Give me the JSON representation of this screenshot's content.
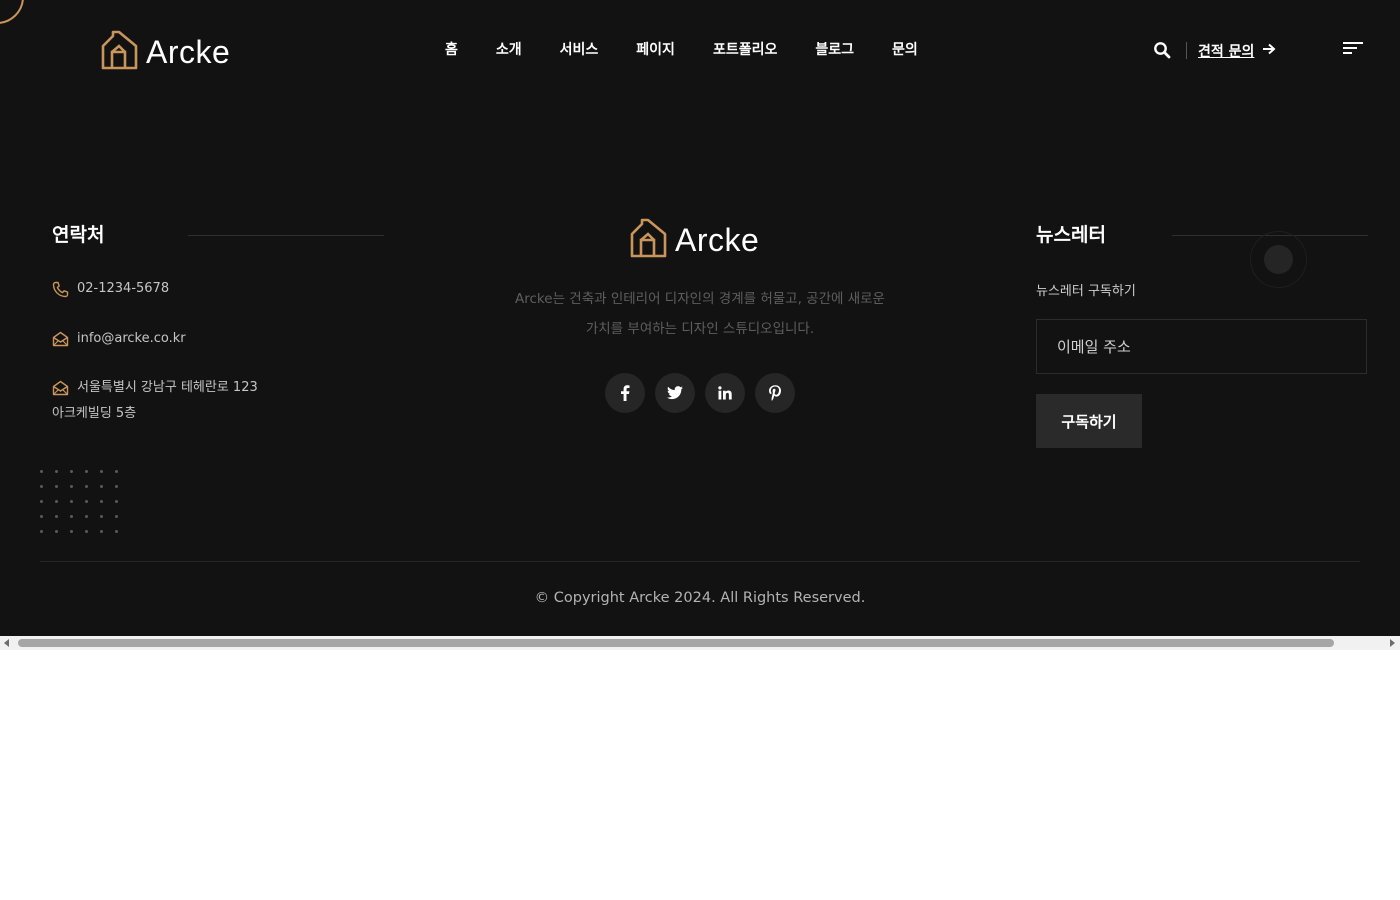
{
  "brand": {
    "name": "Arcke",
    "accent_color": "#c9955a",
    "logo_icon": "house-icon"
  },
  "nav": {
    "items": [
      "홈",
      "소개",
      "서비스",
      "페이지",
      "포트폴리오",
      "블로그",
      "문의"
    ]
  },
  "header": {
    "quote_label": "견적 문의",
    "search_icon": "search-icon",
    "arrow_icon": "arrow-right-icon",
    "menu_icon": "hamburger-menu-icon"
  },
  "contact": {
    "title": "연락처",
    "phone": "02-1234-5678",
    "email": "info@arcke.co.kr",
    "address_line1": "서울특별시 강남구 테헤란로 123",
    "address_line2": "아크케빌딩 5층"
  },
  "about": {
    "description_line1": "Arcke는 건축과 인테리어 디자인의 경계를 허물고, 공간에 새로운",
    "description_line2": "가치를 부여하는 디자인 스튜디오입니다.",
    "socials": [
      "facebook-icon",
      "twitter-icon",
      "linkedin-icon",
      "pinterest-icon"
    ]
  },
  "newsletter": {
    "title": "뉴스레터",
    "label": "뉴스레터 구독하기",
    "email_placeholder": "이메일 주소",
    "email_value": "",
    "subscribe_label": "구독하기"
  },
  "footer": {
    "copyright": "© Copyright Arcke 2024. All Rights Reserved."
  },
  "colors": {
    "background": "#121212",
    "text": "#ffffff",
    "muted": "#5e5e5e",
    "button": "#2a2a2a"
  }
}
